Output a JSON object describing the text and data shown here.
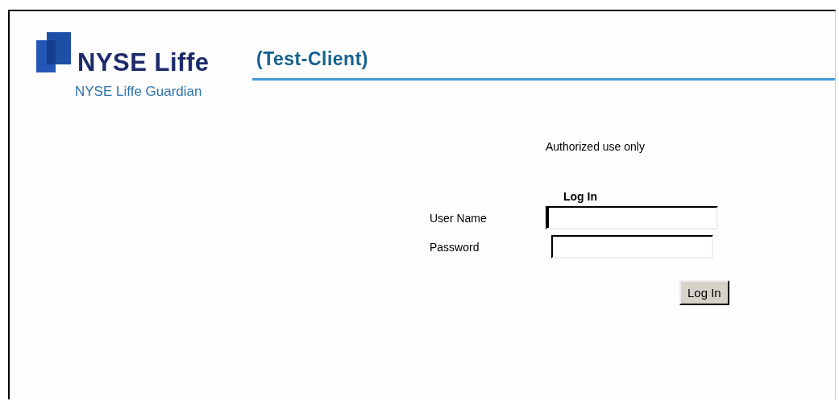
{
  "brand": {
    "wordmark": "NYSE Liffe",
    "product": "NYSE Liffe Guardian"
  },
  "page_title": "(Test-Client)",
  "notice": "Authorized use only",
  "form": {
    "heading": "Log In",
    "fields": [
      {
        "label": "User Name",
        "focused": true
      },
      {
        "label": "Password",
        "focused": false
      }
    ],
    "submit": "Log In"
  }
}
